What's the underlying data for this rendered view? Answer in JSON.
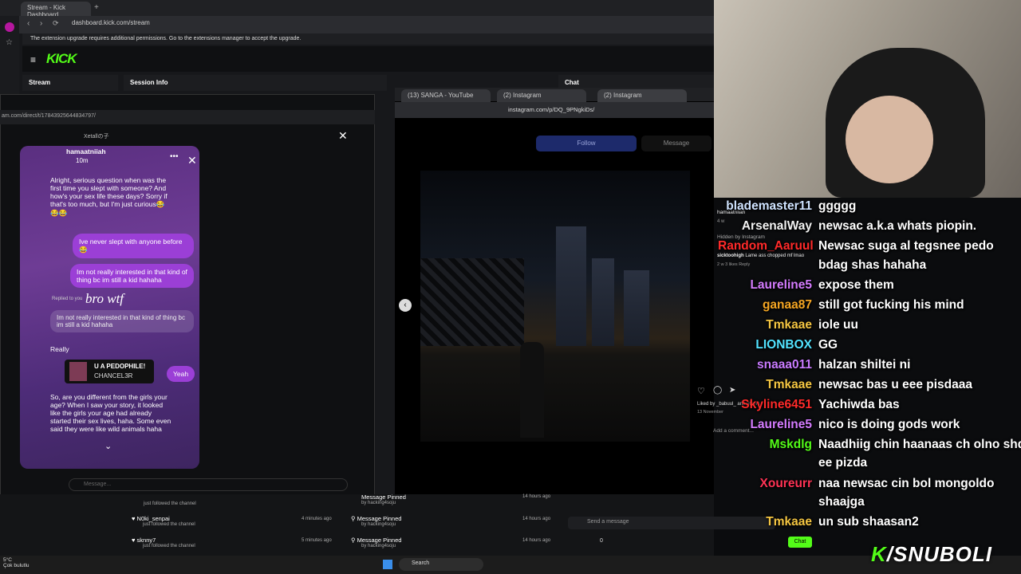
{
  "browser": {
    "tab_title": "Stream - Kick Dashboard",
    "url": "dashboard.kick.com/stream",
    "notice": "The extension upgrade requires additional permissions. Go to the extensions manager to accept the upgrade."
  },
  "kick": {
    "logo": "KICK",
    "nav_stream": "Stream",
    "session_info": "Session Info",
    "chat_tab": "Chat",
    "send_placeholder": "Send a message",
    "chat_button": "Chat",
    "viewer_count": "0"
  },
  "dm": {
    "url": "am.com/direct/t/17843925644834797/",
    "user": "hamaatniiah",
    "time": "10m",
    "header_name": "Xetallの子",
    "messages": [
      "Alright, serious question when was the first time you slept with someone? And how's your sex life these days? Sorry if that's too much, but I'm just curious😂😂😂",
      "Ive never slept with anyone before 😂",
      "Im not really interested in that kind of thing bc im still a kid hahaha",
      "Replied to you",
      "bro wtf",
      "Im not really interested in that kind of thing bc im still a kid hahaha",
      "Really",
      "U A PEDOPHILE!",
      "CHANCEL3R",
      "Yeah",
      "So, are you different from the girls your age? When I saw your story, it looked like the girls your age had already started their sex lives, haha. Some even said they were like wild animals haha"
    ],
    "message_placeholder": "Message..."
  },
  "instagram": {
    "tabs": [
      "(13) SANGA - YouTube",
      "(2) Instagram",
      "(2) Instagram"
    ],
    "url": "instagram.com/p/DQ_9PNgkiDs/",
    "follow": "Follow",
    "message": "Message",
    "comment_user": "hamaatniiah",
    "comment_time": "4 w",
    "hidden": "Hidden by Instagram",
    "comment2_user": "sicktoohigh",
    "comment2_text": "Lame ass chopped mf lmao",
    "comment2_meta": "2 w  3 likes  Reply",
    "liked_by": "Liked by _babuul_ and others",
    "date": "13 November",
    "add_comment": "Add a comment..."
  },
  "stream_chat": [
    {
      "name": "blademaster11",
      "msg": "ggggg",
      "color": "#cfe3ff"
    },
    {
      "name": "ArsenalWay",
      "msg": "newsac a.k.a whats piopin.",
      "color": "#f2f2f2"
    },
    {
      "name": "Random_Aaruul",
      "msg": "Newsac suga al tegsnee pedo",
      "color": "#ff2a2a"
    },
    {
      "name": "",
      "msg": "bdag shas hahaha",
      "color": "#ffffff"
    },
    {
      "name": "Laureline5",
      "msg": "expose them",
      "color": "#d57cff"
    },
    {
      "name": "ganaa87",
      "msg": "still got fucking his mind",
      "color": "#f5a623"
    },
    {
      "name": "Tmkaae",
      "msg": "iole uu",
      "color": "#f5c642"
    },
    {
      "name": "LIONBOX",
      "msg": "GG",
      "color": "#52e3ff"
    },
    {
      "name": "snaaa011",
      "msg": "halzan shiltei ni",
      "color": "#c97bff"
    },
    {
      "name": "Tmkaae",
      "msg": "newsac bas u eee pisdaaa",
      "color": "#f5c642"
    },
    {
      "name": "Skyline6451",
      "msg": "Yachiwda bas",
      "color": "#ff2a2a"
    },
    {
      "name": "Laureline5",
      "msg": "nico is doing gods work",
      "color": "#d57cff"
    },
    {
      "name": "Mskdlg",
      "msg": "Naadhiig chin haanaas ch olno shd",
      "color": "#53fc18"
    },
    {
      "name": "",
      "msg": "ee pizda",
      "color": "#ffffff"
    },
    {
      "name": "Xoureurr",
      "msg": "naa newsac cin bol mongoldo",
      "color": "#ff3355"
    },
    {
      "name": "",
      "msg": "shaajga",
      "color": "#ffffff"
    },
    {
      "name": "Tmkaae",
      "msg": "un sub shaasan2",
      "color": "#f5c642"
    }
  ],
  "activity": [
    {
      "title": "",
      "sub": "just followed the channel",
      "time": ""
    },
    {
      "title": "N0ki_senpai",
      "sub": "just followed the channel",
      "time": "4 minutes ago"
    },
    {
      "title": "sknny7",
      "sub": "just followed the channel",
      "time": "5 minutes ago"
    }
  ],
  "pinned": [
    {
      "title": "Message Pinned",
      "sub": "by hacking4soju",
      "time": "14 hours ago"
    },
    {
      "title": "Message Pinned",
      "sub": "by hacking4soju",
      "time": "14 hours ago"
    },
    {
      "title": "Message Pinned",
      "sub": "by hacking4soju",
      "time": "14 hours ago"
    }
  ],
  "taskbar": {
    "search": "Search",
    "weather": "5°C",
    "weather_sub": "Çok bulutlu"
  },
  "overlay": {
    "handle": "/SNUBOLI"
  },
  "colors": {
    "kick_green": "#53fc18",
    "dm_bubble": "#9b3fd6"
  }
}
